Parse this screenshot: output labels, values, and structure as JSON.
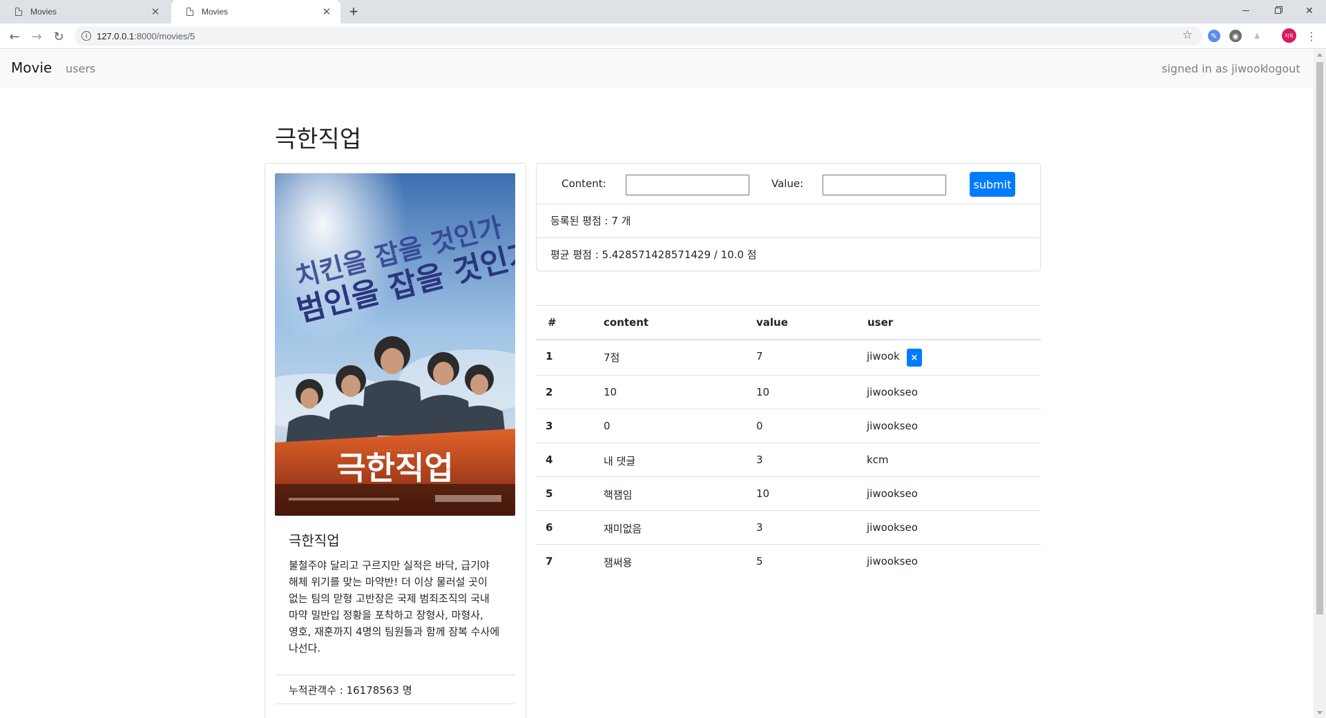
{
  "browser": {
    "tabs": [
      {
        "title": "Movies",
        "active": false
      },
      {
        "title": "Movies",
        "active": true
      }
    ],
    "url_host": "127.0.0.1",
    "url_path": ":8000/movies/5",
    "profile_label": "지욱"
  },
  "navbar": {
    "brand": "Movie",
    "users_link": "users",
    "signed_in": "signed in as jiwook",
    "logout": "logout"
  },
  "movie": {
    "page_title": "극한직업",
    "poster_title": "극한직업",
    "poster_tagline_1": "치킨을 잡을 것인가",
    "poster_tagline_2": "범인을 잡을 것인가",
    "card_title": "극한직업",
    "description": "불철주야 달리고 구르지만 실적은 바닥, 급기야 해체 위기를 맞는 마약반! 더 이상 물러설 곳이 없는 팀의 맏형 고반장은 국제 범죄조직의 국내 마약 밀반입 정황을 포착하고 장형사, 마형사, 영호, 재훈까지 4명의 팀원들과 함께 잠복 수사에 나선다.",
    "audience": "누적관객수 : 16178563 명"
  },
  "form": {
    "content_label": "Content:",
    "value_label": "Value:",
    "content_value": "",
    "value_value": "",
    "submit_label": "submit",
    "count_text": "등록된 평점 : 7 개",
    "average_text": "평균 평점 : 5.428571428571429 / 10.0 점"
  },
  "table": {
    "headers": [
      "#",
      "content",
      "value",
      "user"
    ],
    "rows": [
      {
        "num": "1",
        "content": "7점",
        "value": "7",
        "user": "jiwook",
        "deletable": true
      },
      {
        "num": "2",
        "content": "10",
        "value": "10",
        "user": "jiwookseo",
        "deletable": false
      },
      {
        "num": "3",
        "content": "0",
        "value": "0",
        "user": "jiwookseo",
        "deletable": false
      },
      {
        "num": "4",
        "content": "내 댓글",
        "value": "3",
        "user": "kcm",
        "deletable": false
      },
      {
        "num": "5",
        "content": "핵잼임",
        "value": "10",
        "user": "jiwookseo",
        "deletable": false
      },
      {
        "num": "6",
        "content": "재미없음",
        "value": "3",
        "user": "jiwookseo",
        "deletable": false
      },
      {
        "num": "7",
        "content": "잼써용",
        "value": "5",
        "user": "jiwookseo",
        "deletable": false
      }
    ],
    "delete_label": "×"
  },
  "colors": {
    "primary": "#007bff",
    "navbar_bg": "#f8f9fa",
    "chrome_bg": "#dee1e6"
  }
}
